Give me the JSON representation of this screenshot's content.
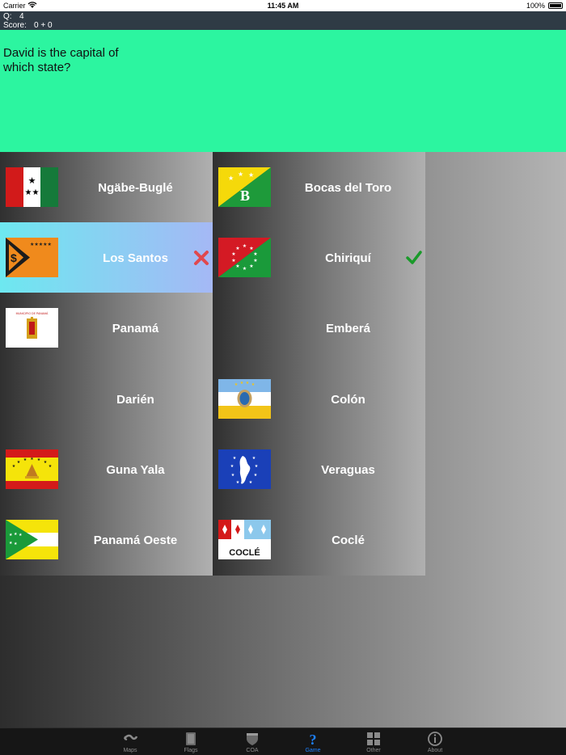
{
  "status": {
    "carrier": "Carrier",
    "time": "11:45 AM",
    "battery": "100%"
  },
  "score": {
    "q_label": "Q:",
    "q_value": "4",
    "score_label": "Score:",
    "score_value": "0 + 0"
  },
  "question": "David is the capital of which state?",
  "answers": [
    {
      "label": "Ngäbe-Buglé",
      "flag": "ngabe-bugle-flag"
    },
    {
      "label": "Bocas del Toro",
      "flag": "bocas-del-toro-flag"
    },
    {
      "label": "Los Santos",
      "flag": "los-santos-flag",
      "mark": "wrong"
    },
    {
      "label": "Chiriquí",
      "flag": "chiriqui-flag",
      "mark": "correct"
    },
    {
      "label": "Panamá",
      "flag": "panama-flag",
      "flag_text": "MUNICIPIO DE PANAMÁ"
    },
    {
      "label": "Emberá",
      "flag": ""
    },
    {
      "label": "Darién",
      "flag": ""
    },
    {
      "label": "Colón",
      "flag": "colon-flag"
    },
    {
      "label": "Guna Yala",
      "flag": "guna-yala-flag"
    },
    {
      "label": "Veraguas",
      "flag": "veraguas-flag"
    },
    {
      "label": "Panamá Oeste",
      "flag": "panama-oeste-flag"
    },
    {
      "label": "Coclé",
      "flag": "cocle-flag",
      "flag_text": "COCLÉ"
    }
  ],
  "tabs": [
    {
      "label": "Maps",
      "icon": "maps-icon"
    },
    {
      "label": "Flags",
      "icon": "flags-icon"
    },
    {
      "label": "COA",
      "icon": "coa-icon"
    },
    {
      "label": "Game",
      "icon": "game-icon",
      "active": true
    },
    {
      "label": "Other",
      "icon": "other-icon"
    },
    {
      "label": "About",
      "icon": "about-icon"
    }
  ],
  "colors": {
    "question_bg": "#2cf5a0",
    "score_bar_bg": "#2f3b45",
    "selected_wrong_bg": "#6de8f0",
    "correct_mark": "#1a9a2a",
    "wrong_mark": "#e0484e",
    "active_tab": "#1e82ff"
  }
}
